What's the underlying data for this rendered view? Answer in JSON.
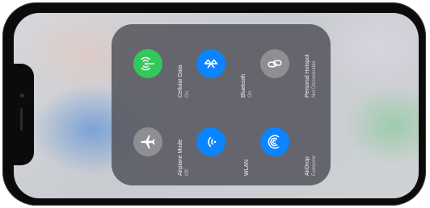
{
  "control_center": {
    "tiles": [
      {
        "key": "cellular",
        "label": "Cellular Data",
        "status": "On",
        "icon": "antenna-icon",
        "color": "#34c759"
      },
      {
        "key": "bluetooth",
        "label": "Bluetooth",
        "status": "On",
        "icon": "bluetooth-icon",
        "color": "#0a84ff"
      },
      {
        "key": "hotspot",
        "label": "Personal Hotspot",
        "status": "Not Discoverable",
        "icon": "chain-link-icon",
        "color": "#8e8e93"
      },
      {
        "key": "airplane",
        "label": "Airplane Mode",
        "status": "Off",
        "icon": "airplane-icon",
        "color": "#8e8e93"
      },
      {
        "key": "wlan",
        "label": "WLAN",
        "status": "",
        "icon": "wifi-icon",
        "color": "#0a84ff"
      },
      {
        "key": "airdrop",
        "label": "AirDrop",
        "status": "Everyone",
        "icon": "airdrop-icon",
        "color": "#0a84ff"
      }
    ]
  }
}
